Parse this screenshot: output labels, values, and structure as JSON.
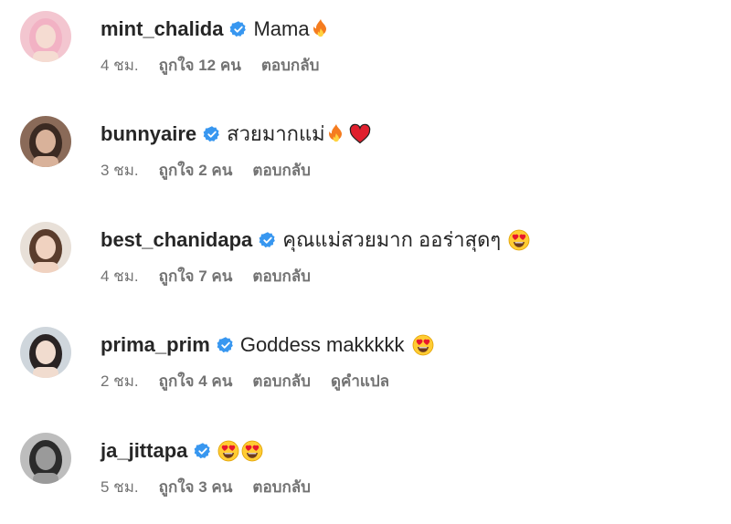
{
  "comments": [
    {
      "username": "mint_chalida",
      "text": "Mama",
      "emojis": [
        "fire-emoji"
      ],
      "time": "4 ชม.",
      "likes": "ถูกใจ 12 คน",
      "reply": "ตอบกลับ",
      "avatar": {
        "bg": "#f3c6d0",
        "hair": "#f2b2c4",
        "skin": "#f5dcd2"
      }
    },
    {
      "username": "bunnyaire",
      "text": "สวยมากแม่",
      "emojis": [
        "fire-emoji",
        "red-heart-emoji"
      ],
      "time": "3 ชม.",
      "likes": "ถูกใจ 2 คน",
      "reply": "ตอบกลับ",
      "avatar": {
        "bg": "#8a6a58",
        "hair": "#3b2a22",
        "skin": "#d9b29a"
      }
    },
    {
      "username": "best_chanidapa",
      "text": "คุณแม่สวยมาก ออร่าสุดๆ",
      "emojis": [
        "heart-eyes-emoji"
      ],
      "time": "4 ชม.",
      "likes": "ถูกใจ 7 คน",
      "reply": "ตอบกลับ",
      "avatar": {
        "bg": "#e8e0d8",
        "hair": "#5a3c2c",
        "skin": "#f0d2c0"
      }
    },
    {
      "username": "prima_prim",
      "text": "Goddess makkkkk",
      "emojis": [
        "heart-eyes-emoji"
      ],
      "time": "2 ชม.",
      "likes": "ถูกใจ 4 คน",
      "reply": "ตอบกลับ",
      "translate": "ดูคำแปล",
      "avatar": {
        "bg": "#cfd6dc",
        "hair": "#2a2424",
        "skin": "#f1dccf"
      }
    },
    {
      "username": "ja_jittapa",
      "text": "",
      "emojis": [
        "heart-eyes-emoji",
        "heart-eyes-emoji"
      ],
      "time": "5 ชม.",
      "likes": "ถูกใจ 3 คน",
      "reply": "ตอบกลับ",
      "avatar": {
        "bg": "#bdbdbd",
        "hair": "#2b2b2b",
        "skin": "#9a9a9a"
      }
    }
  ],
  "colors": {
    "verified": "#3897f0",
    "meta": "#737373",
    "text": "#262626"
  }
}
